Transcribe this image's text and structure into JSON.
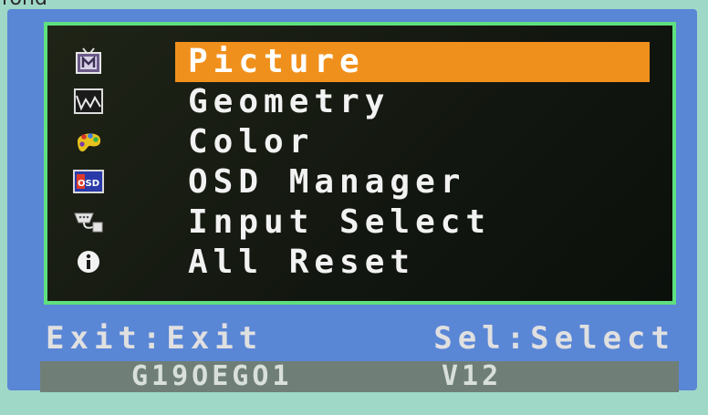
{
  "page_top_text": "rond",
  "menu": {
    "items": [
      {
        "label": "Picture",
        "icon": "tv-picture-icon",
        "selected": true
      },
      {
        "label": "Geometry",
        "icon": "geometry-waveform-icon",
        "selected": false
      },
      {
        "label": "Color",
        "icon": "color-palette-icon",
        "selected": false
      },
      {
        "label": "OSD Manager",
        "icon": "osd-icon",
        "selected": false
      },
      {
        "label": "Input Select",
        "icon": "input-connector-icon",
        "selected": false
      },
      {
        "label": "All Reset",
        "icon": "info-icon",
        "selected": false
      }
    ],
    "osd_icon_text": "OSD"
  },
  "status": {
    "exit": "Exit:Exit",
    "select": "Sel:Select"
  },
  "info": {
    "model": "G19OEGO1",
    "version": "V12"
  },
  "colors": {
    "osd_frame": "#5a86d6",
    "panel_border": "#5fe07f",
    "selected_bar": "#f0901c",
    "info_bar": "#6f7f77"
  }
}
